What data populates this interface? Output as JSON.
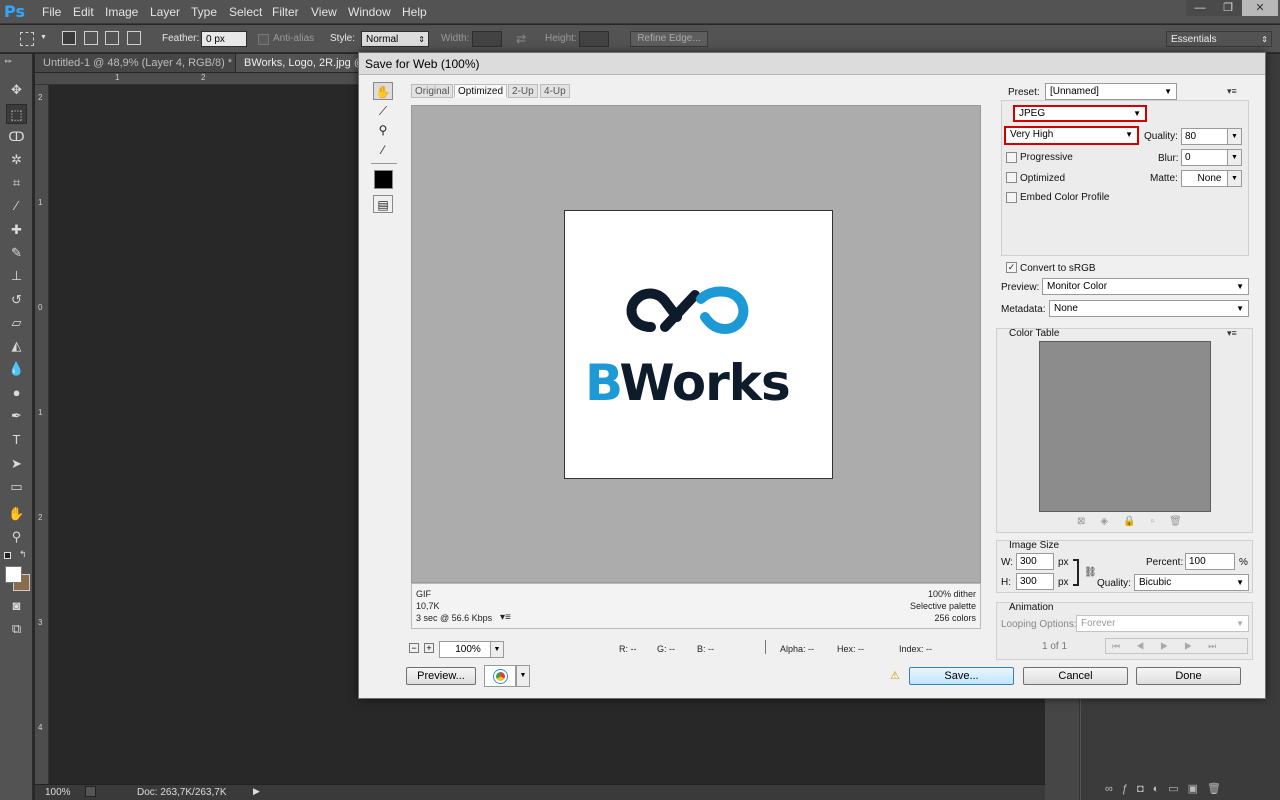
{
  "app": {
    "logo": "Ps",
    "menu": [
      "File",
      "Edit",
      "Image",
      "Layer",
      "Type",
      "Select",
      "Filter",
      "View",
      "Window",
      "Help"
    ],
    "window_controls": [
      "—",
      "❐",
      "✕"
    ]
  },
  "options_bar": {
    "feather_label": "Feather:",
    "feather_value": "0 px",
    "antialias_label": "Anti-alias",
    "style_label": "Style:",
    "style_value": "Normal",
    "width_label": "Width:",
    "height_label": "Height:",
    "refine_edge": "Refine Edge...",
    "workspace": "Essentials"
  },
  "doc_tabs": [
    {
      "label": "Untitled-1 @ 48,9% (Layer 4, RGB/8) *",
      "close": "×"
    },
    {
      "label": "BWorks, Logo, 2R.jpg @",
      "close": ""
    }
  ],
  "rulers": {
    "top": [
      "1",
      "2"
    ],
    "left": [
      "2",
      "1",
      "0",
      "1",
      "2",
      "3",
      "4"
    ]
  },
  "statusbar": {
    "zoom": "100%",
    "doc": "Doc: 263,7K/263,7K"
  },
  "dialog": {
    "title": "Save for Web (100%)",
    "view_tabs": [
      "Original",
      "Optimized",
      "2-Up",
      "4-Up"
    ],
    "active_tab": "Optimized",
    "logo": {
      "text_b": "B",
      "text_rest": "Works",
      "blue": "#1d9ad6",
      "dark": "#0d1b2a"
    },
    "info": {
      "format": "GIF",
      "size": "10,7K",
      "time": "3 sec @ 56.6 Kbps",
      "dither": "100% dither",
      "palette": "Selective palette",
      "colors": "256 colors"
    },
    "zoom_value": "100%",
    "pixel_info": {
      "r": "R: --",
      "g": "G: --",
      "b": "B: --",
      "alpha": "Alpha: --",
      "hex": "Hex: --",
      "index": "Index: --"
    },
    "buttons": {
      "preview": "Preview...",
      "save": "Save...",
      "cancel": "Cancel",
      "done": "Done"
    },
    "settings": {
      "preset_label": "Preset:",
      "preset_value": "[Unnamed]",
      "format_value": "JPEG",
      "quality_preset": "Very High",
      "quality_label": "Quality:",
      "quality_value": "80",
      "progressive": "Progressive",
      "blur_label": "Blur:",
      "blur_value": "0",
      "optimized": "Optimized",
      "matte_label": "Matte:",
      "matte_value": "None",
      "embed_profile": "Embed Color Profile",
      "convert_srgb": "Convert to sRGB",
      "preview_label": "Preview:",
      "preview_value": "Monitor Color",
      "metadata_label": "Metadata:",
      "metadata_value": "None",
      "color_table": "Color Table",
      "image_size": "Image Size",
      "w_label": "W:",
      "w_value": "300",
      "h_label": "H:",
      "h_value": "300",
      "px": "px",
      "percent_label": "Percent:",
      "percent_value": "100",
      "percent_unit": "%",
      "resample_label": "Quality:",
      "resample_value": "Bicubic",
      "animation": "Animation",
      "looping_label": "Looping Options:",
      "looping_value": "Forever",
      "frame_count": "1 of 1"
    },
    "highlight_color": "#d40000"
  }
}
